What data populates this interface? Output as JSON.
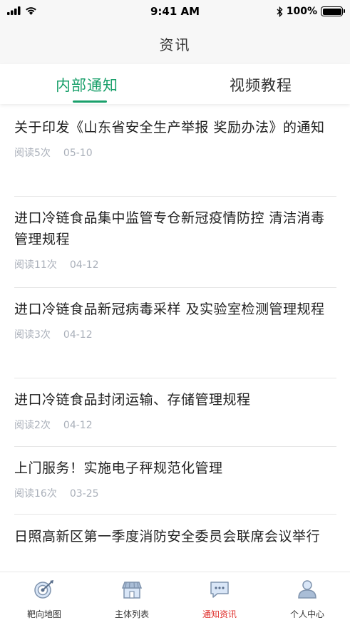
{
  "status_bar": {
    "time": "9:41 AM",
    "battery": "100%"
  },
  "nav": {
    "title": "资讯"
  },
  "tabs": [
    {
      "label": "内部通知",
      "active": true
    },
    {
      "label": "视频教程",
      "active": false
    }
  ],
  "articles": [
    {
      "title": "关于印发《山东省安全生产举报 奖励办法》的通知",
      "reads": "阅读5次",
      "date": "05-10"
    },
    {
      "title": "进口冷链食品集中监管专仓新冠疫情防控 清洁消毒管理规程",
      "reads": "阅读11次",
      "date": "04-12"
    },
    {
      "title": "进口冷链食品新冠病毒采样 及实验室检测管理规程",
      "reads": "阅读3次",
      "date": "04-12"
    },
    {
      "title": "进口冷链食品封闭运输、存储管理规程",
      "reads": "阅读2次",
      "date": "04-12"
    },
    {
      "title": "上门服务！实施电子秤规范化管理",
      "reads": "阅读16次",
      "date": "03-25"
    },
    {
      "title": "日照高新区第一季度消防安全委员会联席会议举行",
      "reads": "",
      "date": ""
    }
  ],
  "tab_bar": [
    {
      "label": "靶向地图",
      "icon": "target-map-icon",
      "active": false
    },
    {
      "label": "主体列表",
      "icon": "store-icon",
      "active": false
    },
    {
      "label": "通知资讯",
      "icon": "chat-bubble-icon",
      "active": true
    },
    {
      "label": "个人中心",
      "icon": "person-icon",
      "active": false
    }
  ],
  "colors": {
    "accent": "#1aa06b",
    "active_tab_bar": "#e0322e",
    "meta_text": "#aab0ba"
  }
}
